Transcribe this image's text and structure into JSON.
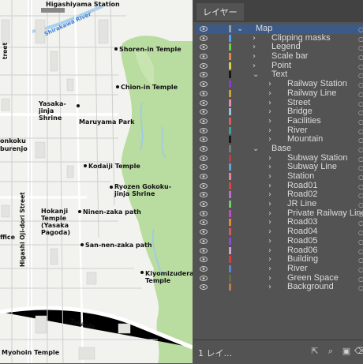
{
  "map": {
    "labels": {
      "higashiyama_station": "Higashiyama Station",
      "shirakawa_river": "Shirakawa River",
      "shoren_in": "Shoren-in Temple",
      "chion_in": "Chion-in Temple",
      "yasaka_jinja": "Yasaka-jinja Shrine",
      "maruyama_park": "Maruyama Park",
      "kodaiji": "Kodaiji Temple",
      "ryozen": "Ryozen Gokoku-jinja Shrine",
      "ninen_zaka": "Ninen-zaka path",
      "hokanji": "Hokanji Temple (Yasaka Pagoda)",
      "higashi_oji": "Higashi Oji-dori Street",
      "sannen_zaka": "San-nen-zaka path",
      "kiyomizudera": "Kiyomizudera Temple",
      "tokaido": "Tokaido",
      "myohoin": "Myohoin Temple",
      "konkoku": "onkoku",
      "burenjo": "burenjo",
      "office": "ffice",
      "street_left": "treet"
    }
  },
  "panel": {
    "tab_label": "レイヤー",
    "footer_count": "1 レイ...",
    "layers": [
      {
        "name": "Map",
        "level": 0,
        "expanded": true,
        "selected": true,
        "color": "#9b9b9b"
      },
      {
        "name": "Clipping masks",
        "level": 1,
        "expanded": false,
        "color": "#4aa0ff"
      },
      {
        "name": "Legend",
        "level": 1,
        "expanded": false,
        "color": "#6ad04a"
      },
      {
        "name": "Scale bar",
        "level": 1,
        "expanded": false,
        "color": "#e08a3a"
      },
      {
        "name": "Point",
        "level": 1,
        "expanded": false,
        "color": "#d4d44a"
      },
      {
        "name": "Text",
        "level": 1,
        "expanded": true,
        "color": "#1a1a1a"
      },
      {
        "name": "Railway Station",
        "level": 2,
        "expanded": false,
        "color": "#8a3ad0"
      },
      {
        "name": "Railway Line",
        "level": 2,
        "expanded": false,
        "color": "#c8a040"
      },
      {
        "name": "Street",
        "level": 2,
        "expanded": false,
        "color": "#e88ab4"
      },
      {
        "name": "Bridge",
        "level": 2,
        "expanded": false,
        "color": "#9cc0d8"
      },
      {
        "name": "Facilities",
        "level": 2,
        "expanded": false,
        "color": "#d06060"
      },
      {
        "name": "River",
        "level": 2,
        "expanded": false,
        "color": "#40a0a0"
      },
      {
        "name": "Mountain",
        "level": 2,
        "expanded": false,
        "color": "#1a1a1a"
      },
      {
        "name": "Base",
        "level": 1,
        "expanded": true,
        "color": "#7a7a7a"
      },
      {
        "name": "Subway Station",
        "level": 2,
        "expanded": false,
        "color": "#b84040"
      },
      {
        "name": "Subway Line",
        "level": 2,
        "expanded": false,
        "color": "#6aa0d8"
      },
      {
        "name": "Station",
        "level": 2,
        "expanded": false,
        "color": "#d88a9a"
      },
      {
        "name": "Road01",
        "level": 2,
        "expanded": false,
        "color": "#e04040"
      },
      {
        "name": "Road02",
        "level": 2,
        "expanded": false,
        "color": "#c06ad0"
      },
      {
        "name": "JR Line",
        "level": 2,
        "expanded": false,
        "color": "#6ad06a"
      },
      {
        "name": "Private Railway Line",
        "level": 2,
        "expanded": false,
        "color": "#c04ac0"
      },
      {
        "name": "Road03",
        "level": 2,
        "expanded": false,
        "color": "#e08a3a"
      },
      {
        "name": "Road04",
        "level": 2,
        "expanded": false,
        "color": "#d05a5a"
      },
      {
        "name": "Road05",
        "level": 2,
        "expanded": false,
        "color": "#8a4ad0"
      },
      {
        "name": "Road06",
        "level": 2,
        "expanded": false,
        "color": "#d0a0d0"
      },
      {
        "name": "Building",
        "level": 2,
        "expanded": false,
        "color": "#d04040"
      },
      {
        "name": "River",
        "level": 2,
        "expanded": false,
        "color": "#5a80e0"
      },
      {
        "name": "Green Space",
        "level": 2,
        "expanded": false,
        "color": "#6a6a3a"
      },
      {
        "name": "Background",
        "level": 2,
        "expanded": false,
        "color": "#c07a4a"
      }
    ]
  }
}
